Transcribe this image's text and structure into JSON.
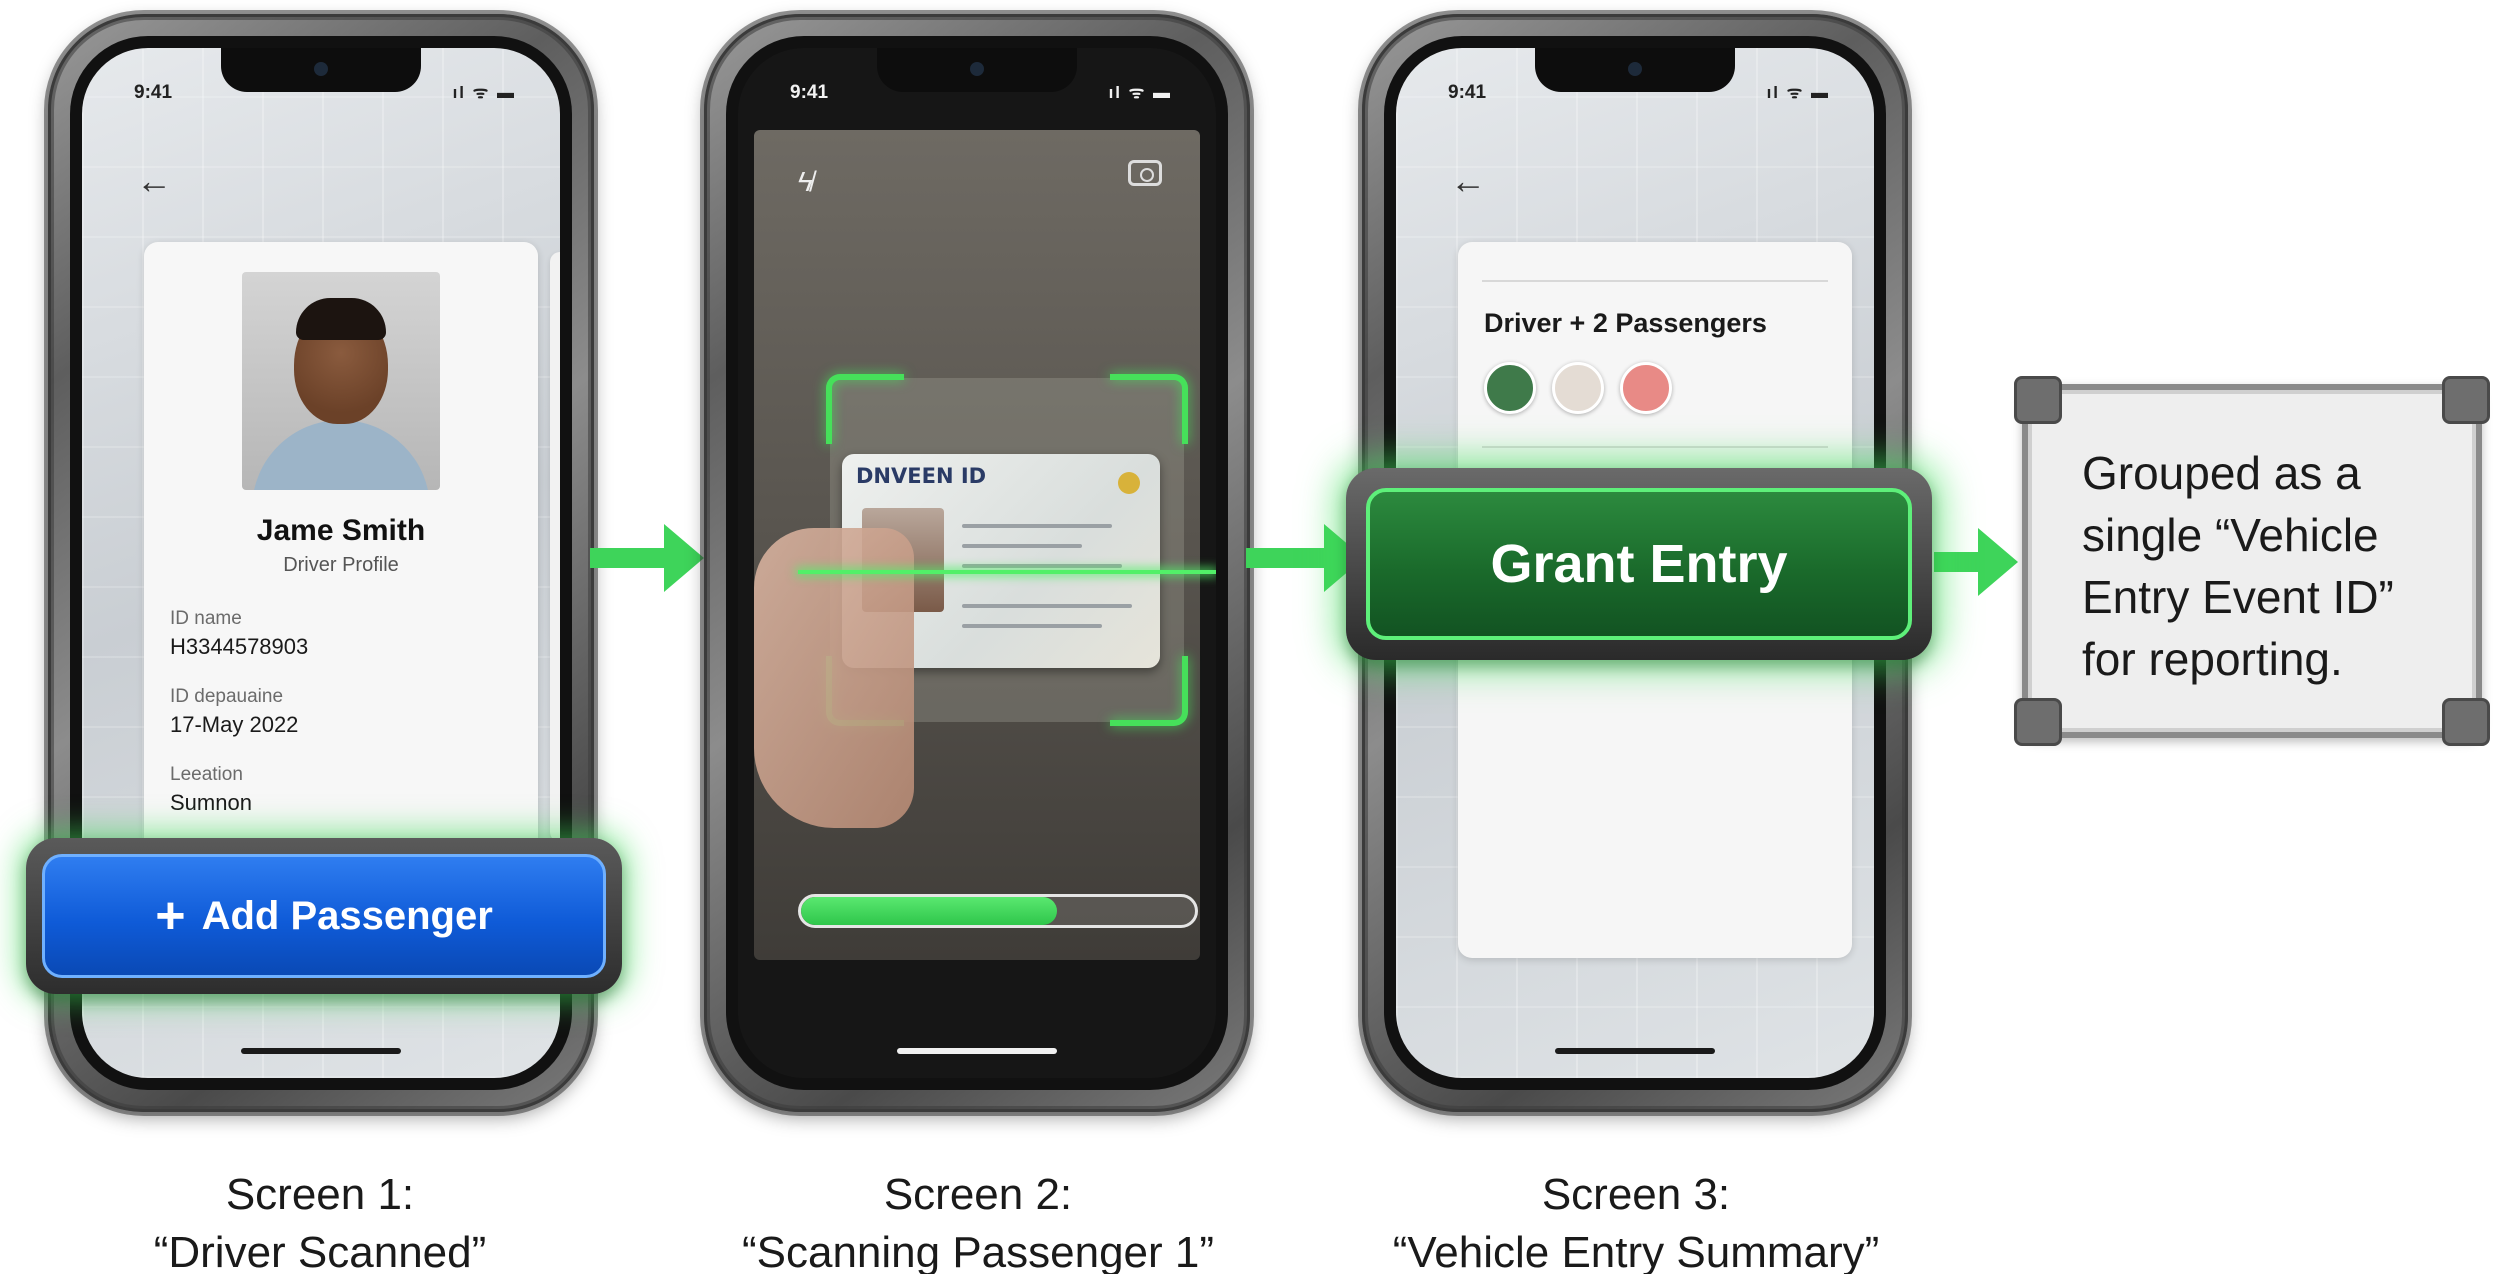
{
  "status_bar": {
    "time": "9:41",
    "icons": "ıl ᯤ ▬"
  },
  "screen1": {
    "profile": {
      "name": "Jame Smith",
      "subtitle": "Driver Profile",
      "fields": [
        {
          "label": "ID name",
          "value": "H3344578903"
        },
        {
          "label": "ID depauaine",
          "value": "17-May 2022"
        },
        {
          "label": "Leeation",
          "value": "Sumnon"
        }
      ]
    },
    "add_passenger_label": "Add Passenger",
    "caption_title": "Screen 1:",
    "caption_subtitle": "“Driver Scanned”"
  },
  "screen2": {
    "id_card_title": "DNVEEN ID",
    "scan_progress": 0.65,
    "caption_title": "Screen 2:",
    "caption_subtitle": "“Scanning Passenger 1”"
  },
  "screen3": {
    "summary_title": "Driver + 2 Passengers",
    "grant_label": "Grant Entry",
    "caption_title": "Screen 3:",
    "caption_subtitle": "“Vehicle Entry Summary”"
  },
  "note": {
    "text": "Grouped as a single “Vehicle Entry Event ID” for reporting."
  },
  "colors": {
    "accent_green": "#3ed45a",
    "primary_blue": "#0f5bd8",
    "grant_green": "#1a6a2b"
  },
  "icons": [
    "back-arrow-icon",
    "flash-off-icon",
    "camera-switch-icon",
    "plus-icon"
  ]
}
